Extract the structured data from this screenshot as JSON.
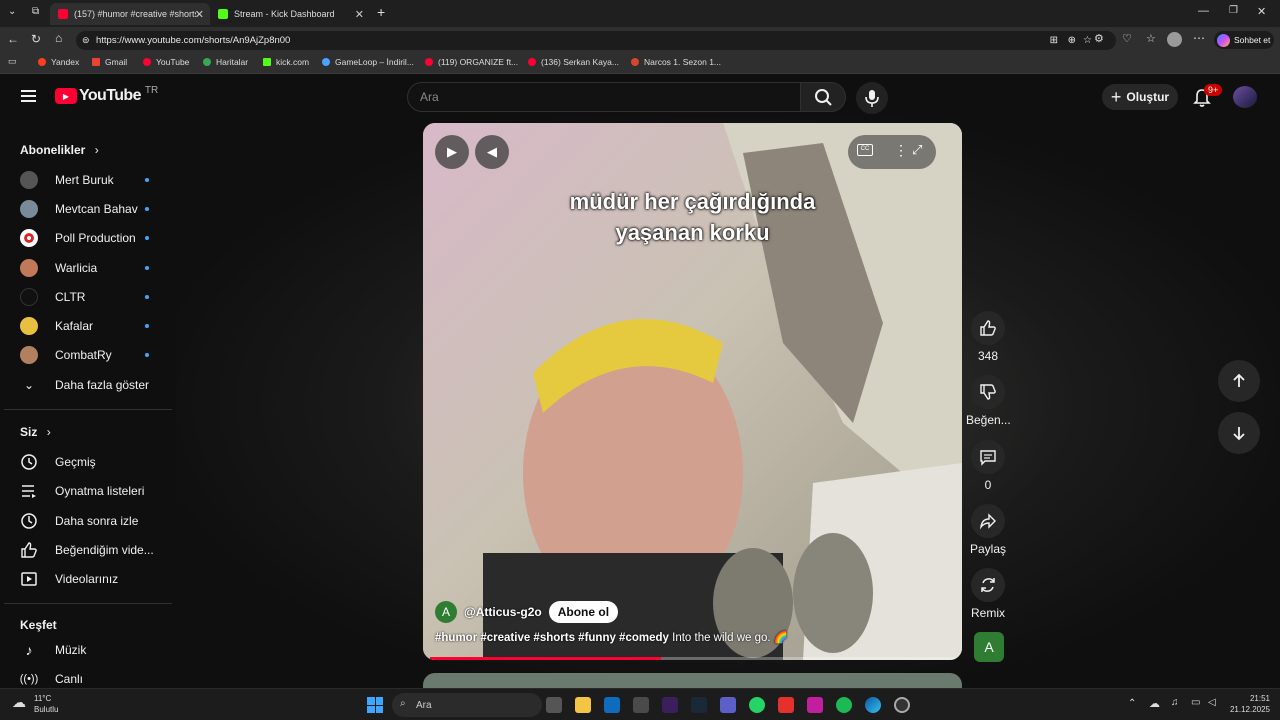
{
  "browser": {
    "tabs": [
      {
        "title": "(157) #humor #creative #shorts #",
        "active": true
      },
      {
        "title": "Stream - Kick Dashboard",
        "active": false
      }
    ],
    "url": "https://www.youtube.com/shorts/An9AjZp8n00",
    "copilot_label": "Sohbet et",
    "bookmarks": [
      "Yandex",
      "Gmail",
      "YouTube",
      "Haritalar",
      "kick.com",
      "GameLoop – İndiril...",
      "(119) ORGANIZE ft...",
      "(136) Serkan Kaya...",
      "Narcos 1. Sezon 1..."
    ]
  },
  "header": {
    "logo_text": "YouTube",
    "region": "TR",
    "search_placeholder": "Ara",
    "create_label": "Oluştur",
    "notification_count": "9+"
  },
  "sidebar": {
    "subscriptions_title": "Abonelikler",
    "subscriptions": [
      {
        "name": "Mert Buruk",
        "color": "#555555"
      },
      {
        "name": "Mevtcan Bahav",
        "color": "#7a8a9a"
      },
      {
        "name": "Poll Production",
        "color": "#ffffff"
      },
      {
        "name": "Warlicia",
        "color": "#c07a5a"
      },
      {
        "name": "CLTR",
        "color": "#111111"
      },
      {
        "name": "Kafalar",
        "color": "#e8c040"
      },
      {
        "name": "CombatRy",
        "color": "#b08060"
      }
    ],
    "show_more": "Daha fazla göster",
    "you_title": "Siz",
    "you_items": [
      {
        "label": "Geçmiş",
        "icon": "history-icon"
      },
      {
        "label": "Oynatma listeleri",
        "icon": "playlist-icon"
      },
      {
        "label": "Daha sonra izle",
        "icon": "clock-icon"
      },
      {
        "label": "Beğendiğim vide...",
        "icon": "thumbs-up-icon"
      },
      {
        "label": "Videolarınız",
        "icon": "video-icon"
      }
    ],
    "explore_title": "Keşfet",
    "explore_items": [
      {
        "label": "Müzik",
        "icon": "music-icon"
      },
      {
        "label": "Canlı",
        "icon": "live-icon"
      }
    ]
  },
  "short": {
    "caption_line1": "müdür her çağırdığında",
    "caption_line2": "yaşanan korku",
    "channel_initial": "A",
    "channel_handle": "@Atticus-g2o",
    "subscribe_label": "Abone ol",
    "hashtags": "#humor #creative #shorts #funny #comedy",
    "description": "Into the wild we go. 🌈",
    "progress": 0.44
  },
  "actions": {
    "like_count": "348",
    "dislike_label": "Beğen...",
    "comment_count": "0",
    "share_label": "Paylaş",
    "remix_label": "Remix",
    "channel_initial": "A"
  },
  "taskbar": {
    "weather_temp": "11°C",
    "weather_desc": "Bulutlu",
    "search_placeholder": "Ara",
    "time": "21:51",
    "date": "21.12.2025"
  }
}
